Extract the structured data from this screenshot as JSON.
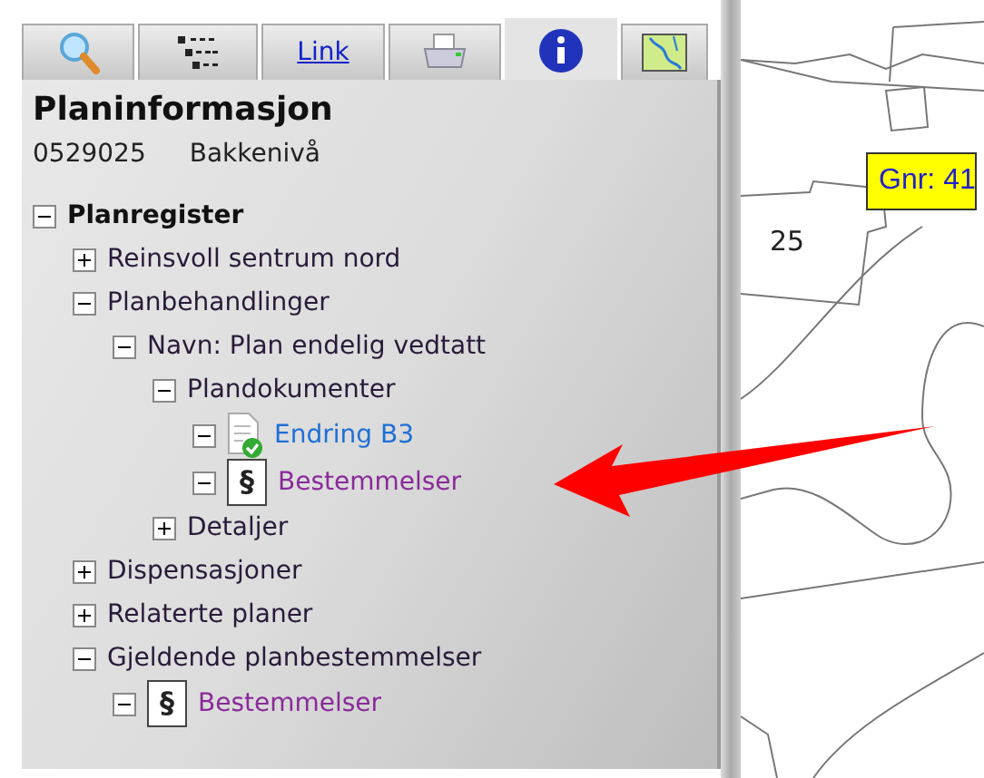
{
  "tabs": [
    {
      "kind": "search",
      "selected": false
    },
    {
      "kind": "legend",
      "selected": false
    },
    {
      "kind": "link",
      "label": "Link",
      "selected": false
    },
    {
      "kind": "print",
      "selected": false
    },
    {
      "kind": "info",
      "selected": true
    },
    {
      "kind": "map",
      "selected": false
    }
  ],
  "panel": {
    "title": "Planinformasjon",
    "plan_id": "0529025",
    "plan_name": "Bakkenivå"
  },
  "tree": [
    {
      "label": "Planregister",
      "kind": "heading",
      "expanded": true,
      "children": [
        {
          "label": "Reinsvoll sentrum nord",
          "kind": "text",
          "expanded": false
        },
        {
          "label": "Planbehandlinger",
          "kind": "text",
          "expanded": true,
          "children": [
            {
              "label": "Navn: Plan endelig vedtatt",
              "kind": "text",
              "expanded": true,
              "children": [
                {
                  "label": "Plandokumenter",
                  "kind": "text",
                  "expanded": true,
                  "children": [
                    {
                      "label": "Endring B3",
                      "kind": "document",
                      "visited": false,
                      "expanded": true
                    },
                    {
                      "label": "Bestemmelser",
                      "kind": "regulation",
                      "icon": "§",
                      "visited": true,
                      "expanded": true
                    }
                  ]
                },
                {
                  "label": "Detaljer",
                  "kind": "text",
                  "expanded": false
                }
              ]
            }
          ]
        },
        {
          "label": "Dispensasjoner",
          "kind": "text",
          "expanded": false
        },
        {
          "label": "Relaterte planer",
          "kind": "text",
          "expanded": false
        },
        {
          "label": "Gjeldende planbestemmelser",
          "kind": "text",
          "expanded": true,
          "children": [
            {
              "label": "Bestemmelser",
              "kind": "regulation",
              "icon": "§",
              "visited": true,
              "expanded": true
            }
          ]
        }
      ]
    }
  ],
  "map": {
    "parcel_label": "25",
    "tooltip": "Gnr: 41"
  }
}
